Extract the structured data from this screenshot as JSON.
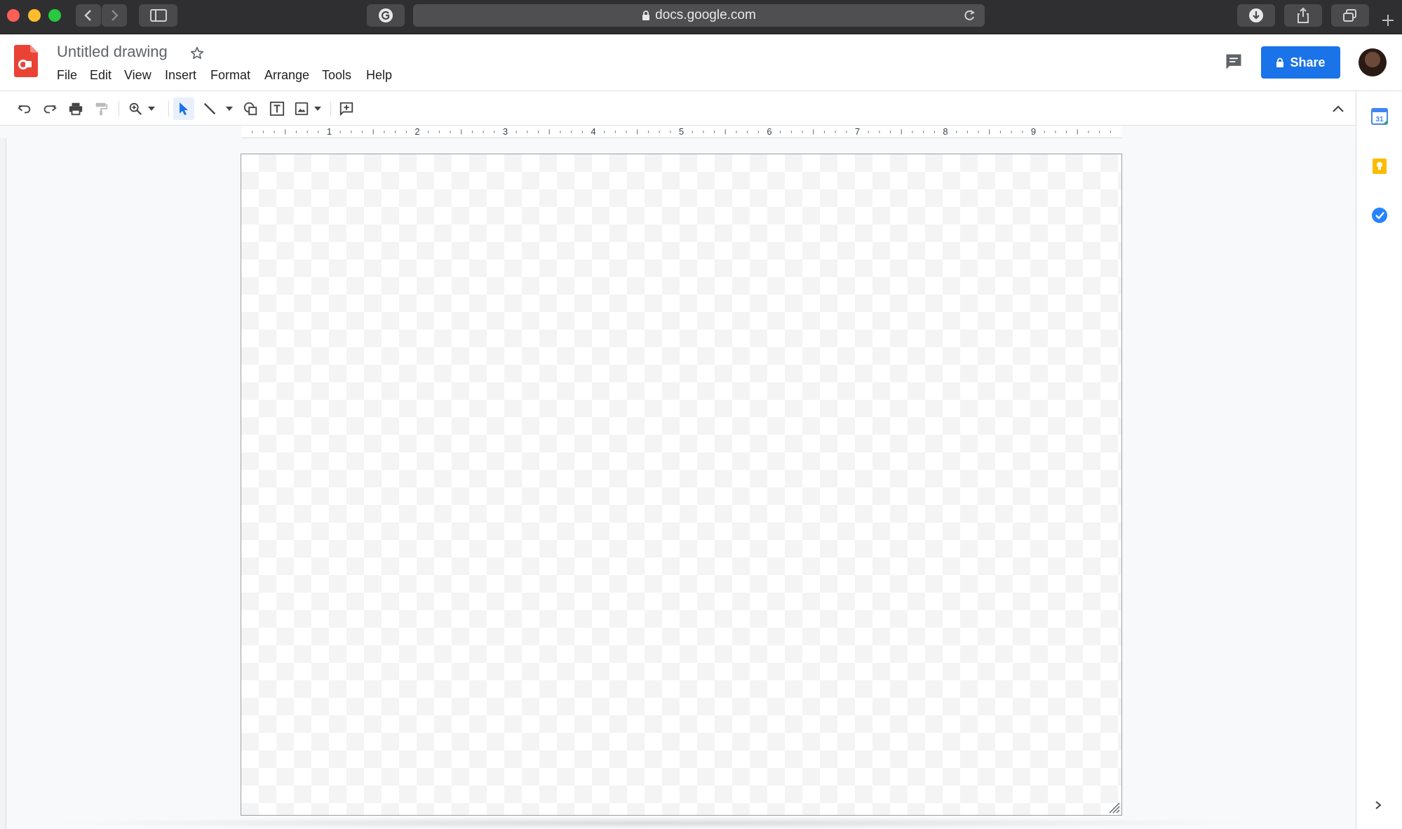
{
  "browser": {
    "url": "docs.google.com"
  },
  "app": {
    "title": "Untitled drawing",
    "menu": [
      "File",
      "Edit",
      "View",
      "Insert",
      "Format",
      "Arrange",
      "Tools",
      "Help"
    ],
    "share_label": "Share"
  },
  "toolbar": {
    "icons": [
      "undo-icon",
      "redo-icon",
      "print-icon",
      "paint-format-icon",
      "zoom-icon",
      "select-icon",
      "line-icon",
      "shape-icon",
      "text-box-icon",
      "image-icon",
      "add-comment-icon",
      "collapse-icon"
    ]
  },
  "ruler": {
    "labels": [
      "1",
      "2",
      "3",
      "4",
      "5",
      "6",
      "7",
      "8",
      "9"
    ]
  },
  "side_panel": {
    "icons": [
      "calendar-icon",
      "keep-icon",
      "tasks-icon",
      "chevron-right-icon"
    ],
    "calendar_day": "31"
  },
  "colors": {
    "accent": "#1a73e8",
    "drawings_logo": "#ea4335",
    "keep": "#fbbc04",
    "tasks": "#2684fc"
  }
}
